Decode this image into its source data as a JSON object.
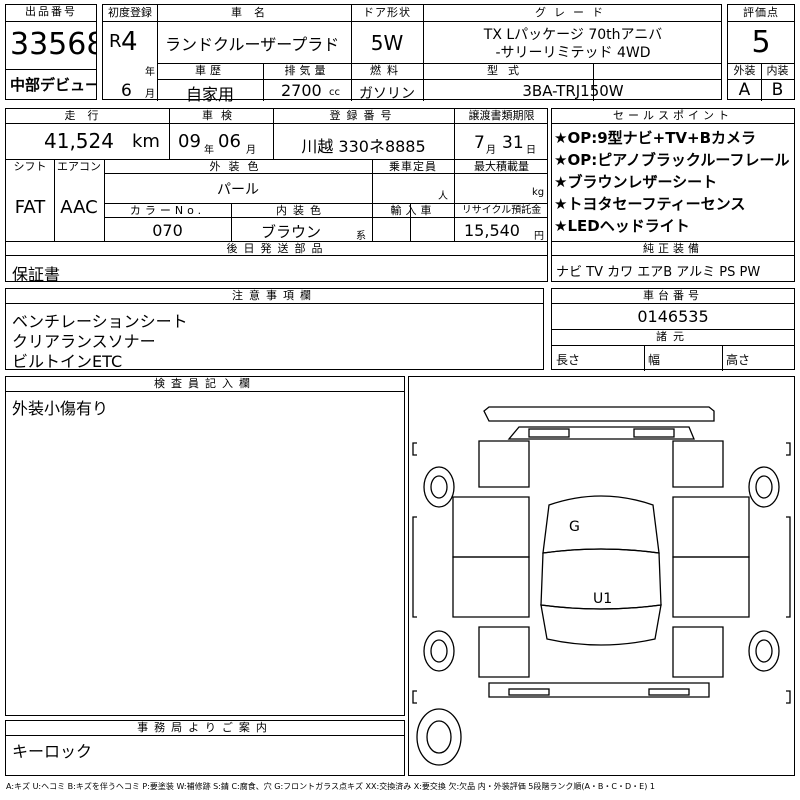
{
  "header": {
    "lot_label": "出品番号",
    "lot_number": "33568",
    "debut": "中部デビュー",
    "first_reg_label": "初度登録",
    "era": "R",
    "year": "4",
    "year_unit": "年",
    "month": "6",
    "month_unit": "月",
    "car_name_label": "車名",
    "car_name": "ランドクルーザープラド",
    "door_label": "ドア形状",
    "door": "5W",
    "grade_label": "グレード",
    "grade_line1": "TX Lパッケージ 70thアニバ",
    "grade_line2": "-サリーリミテッド 4WD",
    "score_label": "評価点",
    "score": "5",
    "history_label": "車歴",
    "history": "自家用",
    "displacement_label": "排気量",
    "displacement": "2700",
    "cc": "cc",
    "fuel_label": "燃料",
    "fuel": "ガソリン",
    "model_label": "型式",
    "model": "3BA-TRJ150W",
    "exterior_label": "外装",
    "exterior_grade": "A",
    "interior_label": "内装",
    "interior_grade": "B"
  },
  "row2": {
    "mileage_label": "走行",
    "mileage": "41,524",
    "km": "km",
    "inspection_label": "車検",
    "insp_year": "09",
    "insp_year_unit": "年",
    "insp_month": "06",
    "insp_month_unit": "月",
    "plate_label": "登録番号",
    "plate": "川越 330ネ8885",
    "transfer_label": "譲渡書類期限",
    "transfer_month": "7",
    "transfer_month_unit": "月",
    "transfer_day": "31",
    "transfer_day_unit": "日",
    "shift_label": "シフト",
    "shift": "FAT",
    "ac_label": "エアコン",
    "ac": "AAC",
    "color_label": "外装色",
    "color": "パール",
    "capacity_label": "乗車定員",
    "capacity_unit": "人",
    "load_label": "最大積載量",
    "load_unit": "kg",
    "color_no_label": "カラーNo.",
    "color_no": "070",
    "int_color_label": "内装色",
    "int_color": "ブラウン",
    "int_color_suffix": "系",
    "import_label": "輸入車",
    "recycle_label": "リサイクル預託金",
    "recycle": "15,540",
    "yen": "円"
  },
  "sales": {
    "label": "セールスポイント",
    "points": [
      "★OP:9型ナビ+TV+Bカメラ",
      "★OP:ピアノブラックルーフレール",
      "★ブラウンレザーシート",
      "★トヨタセーフティーセンス",
      "★LEDヘッドライト"
    ],
    "equipment_label": "純正装備",
    "equipment": "ナビ TV カワ エアB アルミ PS PW"
  },
  "later_parts": {
    "label": "後日発送部品",
    "value": "保証書"
  },
  "notes": {
    "label": "注意事項欄",
    "lines": [
      "ベンチレーションシート",
      "クリアランスソナー",
      "ビルトインETC"
    ]
  },
  "chassis": {
    "label": "車台番号",
    "value": "0146535",
    "dims_label": "諸元",
    "length": "長さ",
    "width": "幅",
    "height": "高さ"
  },
  "inspector": {
    "label": "検査員記入欄",
    "value": "外装小傷有り"
  },
  "office": {
    "label": "事務局よりご案内",
    "value": "キーロック"
  },
  "diagram": {
    "mark_g": "G",
    "mark_u1": "U1"
  },
  "legend": "A:キズ U:ヘコミ B:キズを伴うヘコミ P:要塗装 W:補修跡 S:錆 C:腐食、穴 G:フロントガラス点キズ XX:交換済み X:要交換 欠:欠品 内・外装評価 5段階ランク順(A・B・C・D・E) 1"
}
